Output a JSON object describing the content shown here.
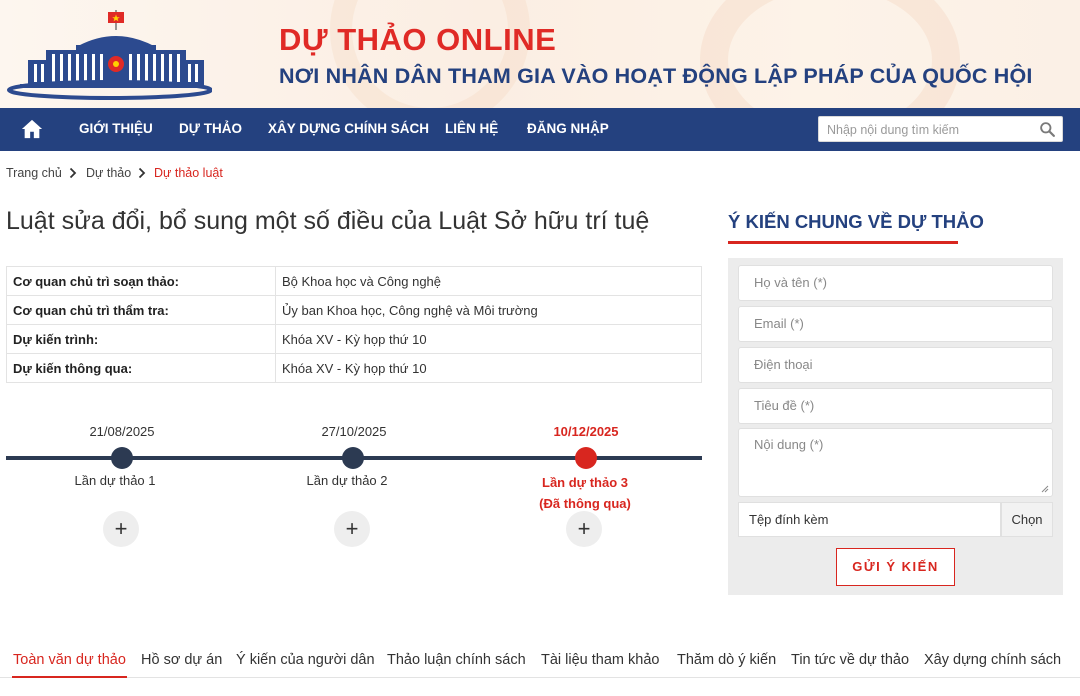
{
  "header": {
    "title": "DỰ THẢO ONLINE",
    "slogan": "NƠI NHÂN DÂN THAM GIA VÀO HOẠT ĐỘNG LẬP PHÁP CỦA QUỐC HỘI"
  },
  "nav": {
    "items": [
      "GIỚI THIỆU",
      "DỰ THẢO",
      "XÂY DỰNG CHÍNH SÁCH",
      "LIÊN HỆ",
      "ĐĂNG NHẬP"
    ],
    "search_placeholder": "Nhập nội dung tìm kiếm"
  },
  "breadcrumb": [
    "Trang chủ",
    "Dự thảo",
    "Dự thảo luật"
  ],
  "page_title": "Luật sửa đổi, bổ sung một số điều của Luật Sở hữu trí tuệ",
  "info_table": [
    {
      "label": "Cơ quan chủ trì soạn thảo:",
      "value": "Bộ Khoa học và Công nghệ"
    },
    {
      "label": "Cơ quan chủ trì thẩm tra:",
      "value": "Ủy ban Khoa học, Công nghệ và Môi trường"
    },
    {
      "label": "Dự kiến trình:",
      "value": "Khóa XV - Kỳ họp thứ 10"
    },
    {
      "label": "Dự kiến thông qua:",
      "value": "Khóa XV - Kỳ họp thứ 10"
    }
  ],
  "timeline": [
    {
      "date": "21/08/2025",
      "label": "Lần dự thảo 1",
      "sublabel": "",
      "plus": "+"
    },
    {
      "date": "27/10/2025",
      "label": "Lần dự thảo 2",
      "sublabel": "",
      "plus": "+"
    },
    {
      "date": "10/12/2025",
      "label": "Lần dự thảo 3",
      "sublabel": "(Đã thông qua)",
      "plus": "+"
    }
  ],
  "feedback": {
    "title": "Ý KIẾN CHUNG VỀ DỰ THẢO",
    "name_placeholder": "Họ và tên (*)",
    "email_placeholder": "Email (*)",
    "phone_placeholder": "Điện thoại",
    "subject_placeholder": "Tiêu đề (*)",
    "content_placeholder": "Nội dung (*)",
    "attachment_label": "Tệp đính kèm",
    "choose_label": "Chọn",
    "submit_label": "GỬI Ý KIẾN"
  },
  "tabs": [
    "Toàn văn dự thảo",
    "Hồ sơ dự án",
    "Ý kiến của người dân",
    "Thảo luận chính sách",
    "Tài liệu tham khảo",
    "Thăm dò ý kiến",
    "Tin tức về dự thảo",
    "Xây dựng chính sách"
  ],
  "icons": {
    "home": "home-icon",
    "search": "search-icon",
    "breadcrumb_separator": "chevron-right-icon",
    "logo": "national-assembly-building-logo"
  },
  "colors": {
    "nav_background": "#24417f",
    "title_red": "#e02a26",
    "accent_red": "#d8261f",
    "slogan_blue": "#24417f",
    "timeline_dark": "#2c3a52"
  }
}
